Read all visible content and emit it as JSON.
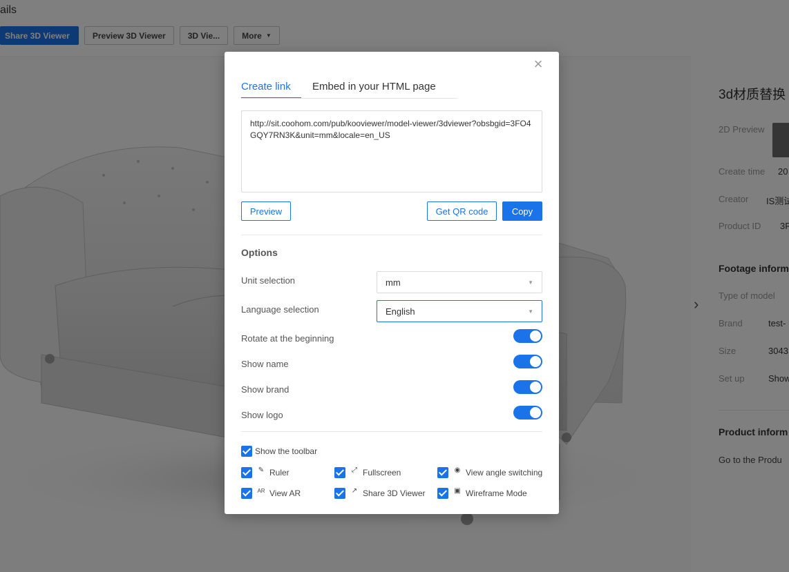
{
  "background": {
    "page_title": "ails",
    "toolbar": {
      "share_label": "Share 3D Viewer",
      "preview_label": "Preview 3D Viewer",
      "viewer_label": "3D Vie...",
      "more_label": "More"
    },
    "side": {
      "name": "3d材质替换",
      "preview_label": "2D Preview",
      "create_time_label": "Create time",
      "create_time_value": "20",
      "creator_label": "Creator",
      "creator_value": "IS测试",
      "product_id_label": "Product ID",
      "product_id_value": "3F",
      "footage_heading": "Footage inform",
      "type_label": "Type of model",
      "brand_label": "Brand",
      "brand_value": "test-",
      "size_label": "Size",
      "size_value": "3043",
      "setup_label": "Set up",
      "setup_value": "Show",
      "product_heading": "Product inform",
      "product_link": "Go to the Produ"
    }
  },
  "modal": {
    "close_icon": "close-icon",
    "tabs": [
      {
        "label": "Create link",
        "active": true
      },
      {
        "label": "Embed in your HTML page",
        "active": false
      }
    ],
    "link_url": "http://sit.coohom.com/pub/kooviewer/model-viewer/3dviewer?obsbgid=3FO4GQY7RN3K&unit=mm&locale=en_US",
    "preview_label": "Preview",
    "qr_label": "Get QR code",
    "copy_label": "Copy",
    "options_title": "Options",
    "unit_label": "Unit selection",
    "unit_value": "mm",
    "language_label": "Language selection",
    "language_value": "English",
    "toggles": [
      {
        "label": "Rotate at the beginning",
        "on": true
      },
      {
        "label": "Show name",
        "on": true
      },
      {
        "label": "Show brand",
        "on": true
      },
      {
        "label": "Show logo",
        "on": true
      }
    ],
    "toolbar_checkbox": "Show the toolbar",
    "tools": [
      {
        "label": "Ruler",
        "icon": "ruler-icon",
        "checked": true
      },
      {
        "label": "Fullscreen",
        "icon": "fullscreen-icon",
        "checked": true
      },
      {
        "label": "View angle switching",
        "icon": "view-angle-icon",
        "checked": true
      },
      {
        "label": "View AR",
        "icon": "ar-icon",
        "icon_text": "AR",
        "checked": true
      },
      {
        "label": "Share 3D Viewer",
        "icon": "share-icon",
        "checked": true
      },
      {
        "label": "Wireframe Mode",
        "icon": "wireframe-icon",
        "checked": true
      }
    ],
    "accent_color": "#1a73e8"
  }
}
